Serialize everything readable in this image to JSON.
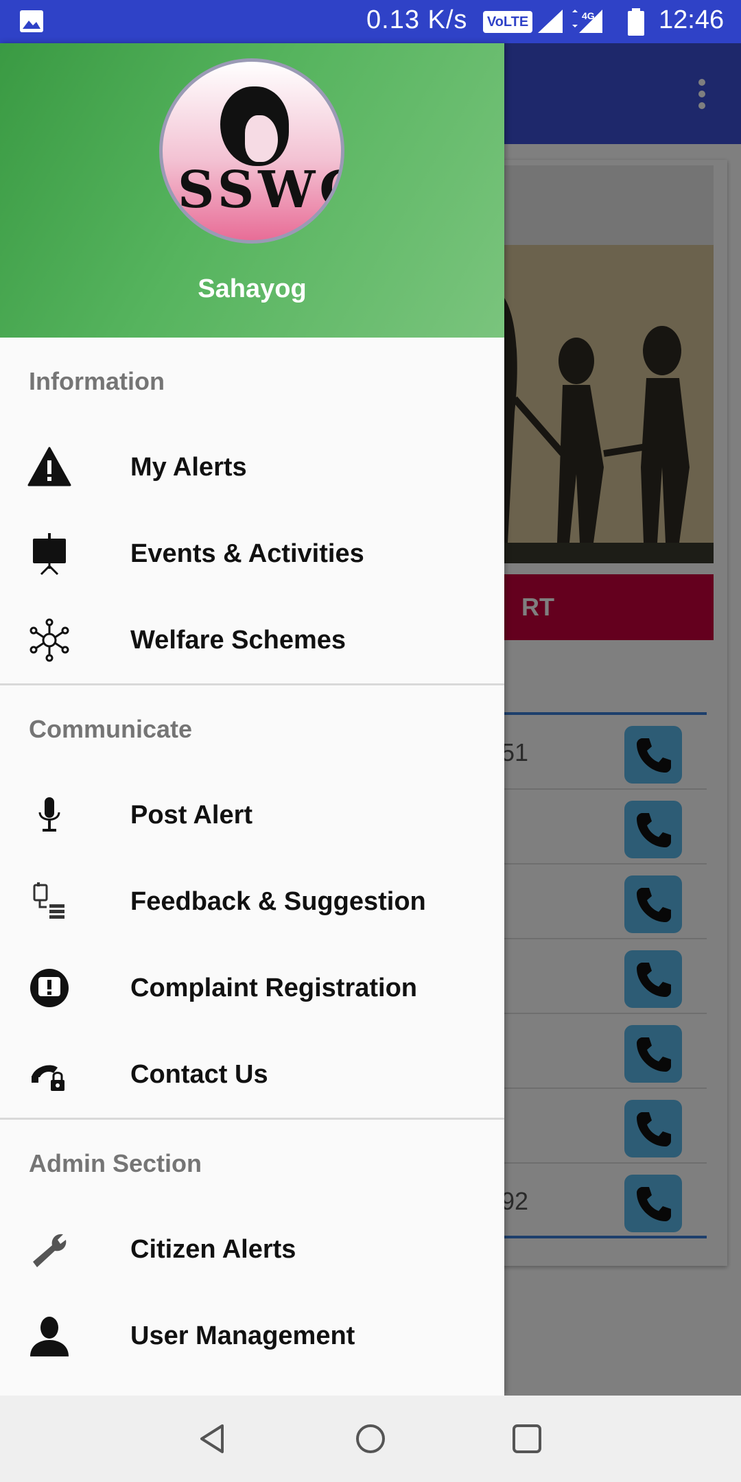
{
  "status_bar": {
    "speed": "0.13 K/s",
    "volte": "VoLTE",
    "network": "4G",
    "time": "12:46"
  },
  "app_behind": {
    "alert_button_text": "RT",
    "list_rows": [
      "51",
      "",
      "",
      "",
      "",
      "",
      "92"
    ]
  },
  "drawer": {
    "app_name": "Sahayog",
    "logo_text": "SSWC",
    "sections": [
      {
        "title": "Information",
        "items": [
          {
            "label": "My Alerts",
            "icon": "warning-icon"
          },
          {
            "label": "Events & Activities",
            "icon": "presentation-board-icon"
          },
          {
            "label": "Welfare Schemes",
            "icon": "network-hub-icon"
          }
        ]
      },
      {
        "title": "Communicate",
        "items": [
          {
            "label": "Post Alert",
            "icon": "microphone-icon"
          },
          {
            "label": "Feedback & Suggestion",
            "icon": "feedback-list-icon"
          },
          {
            "label": "Complaint Registration",
            "icon": "complaint-bubble-icon"
          },
          {
            "label": "Contact Us",
            "icon": "phone-lock-icon"
          }
        ]
      },
      {
        "title": "Admin Section",
        "items": [
          {
            "label": "Citizen Alerts",
            "icon": "wrench-icon"
          },
          {
            "label": "User Management",
            "icon": "user-icon"
          }
        ]
      }
    ]
  },
  "colors": {
    "status_bar": "#2f42c7",
    "header_green": "#56b45e",
    "alert_red": "#c8003c",
    "call_blue": "#5bb8ea"
  }
}
